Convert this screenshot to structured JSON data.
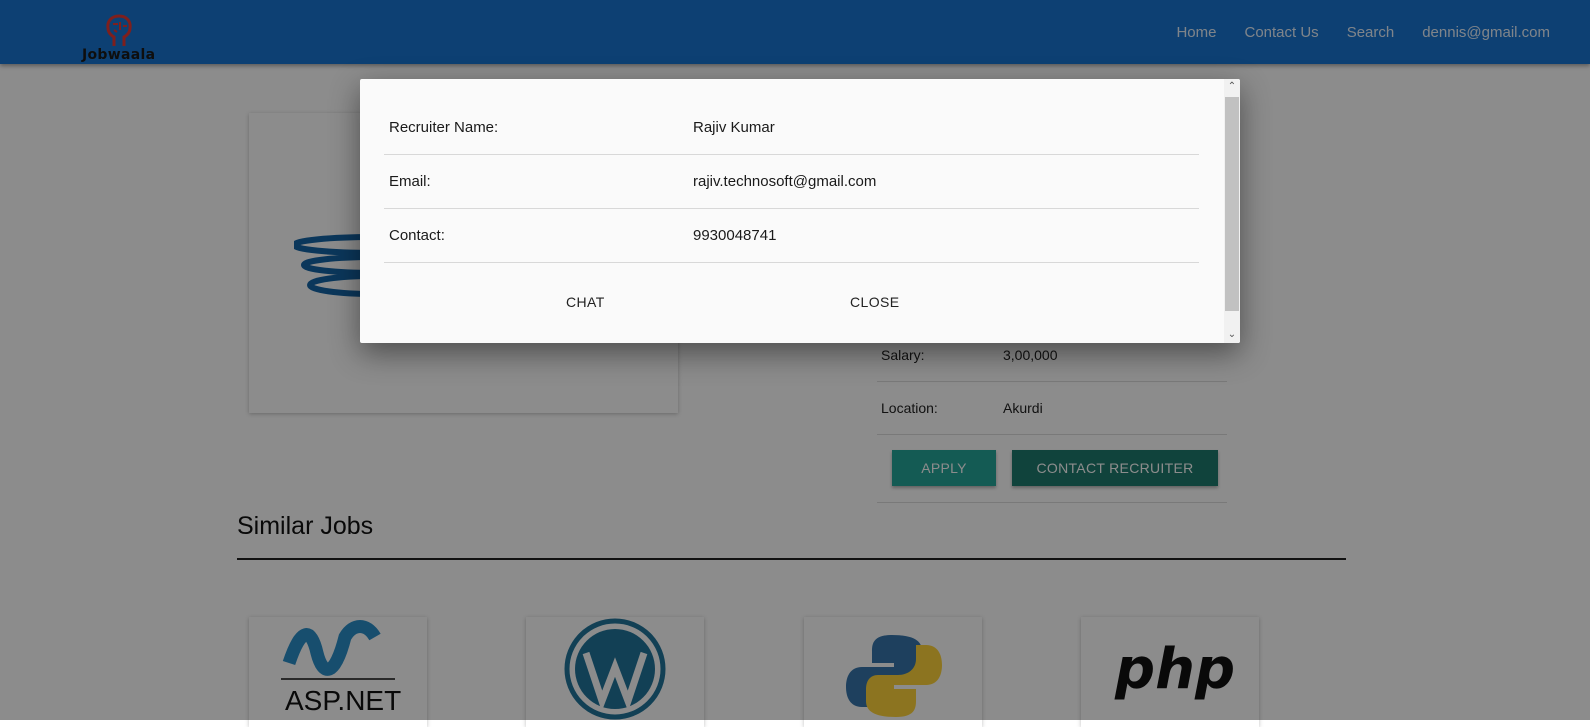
{
  "header": {
    "brand": "Jobwaala",
    "nav": [
      "Home",
      "Contact Us",
      "Search",
      "dennis@gmail.com"
    ]
  },
  "job": {
    "salary_label": "Salary:",
    "salary_value": "3,00,000",
    "location_label": "Location:",
    "location_value": "Akurdi",
    "apply_label": "APPLY",
    "contact_label": "CONTACT RECRUITER"
  },
  "similar": {
    "title": "Similar Jobs",
    "logos": [
      "ASP.NET",
      "php"
    ]
  },
  "dialog": {
    "rows": [
      {
        "label": "Recruiter Name:",
        "value": "Rajiv Kumar"
      },
      {
        "label": "Email:",
        "value": "rajiv.technosoft@gmail.com"
      },
      {
        "label": "Contact:",
        "value": "9930048741"
      }
    ],
    "chat_label": "CHAT",
    "close_label": "CLOSE"
  },
  "colors": {
    "header": "#1976d2",
    "apply_button": "#26a69a",
    "contact_button": "#1e7b6e",
    "java_red": "#e51f24",
    "java_blue": "#1565a7",
    "wordpress_blue": "#21759b",
    "python_blue": "#3776ab",
    "python_yellow": "#ffd43b"
  }
}
